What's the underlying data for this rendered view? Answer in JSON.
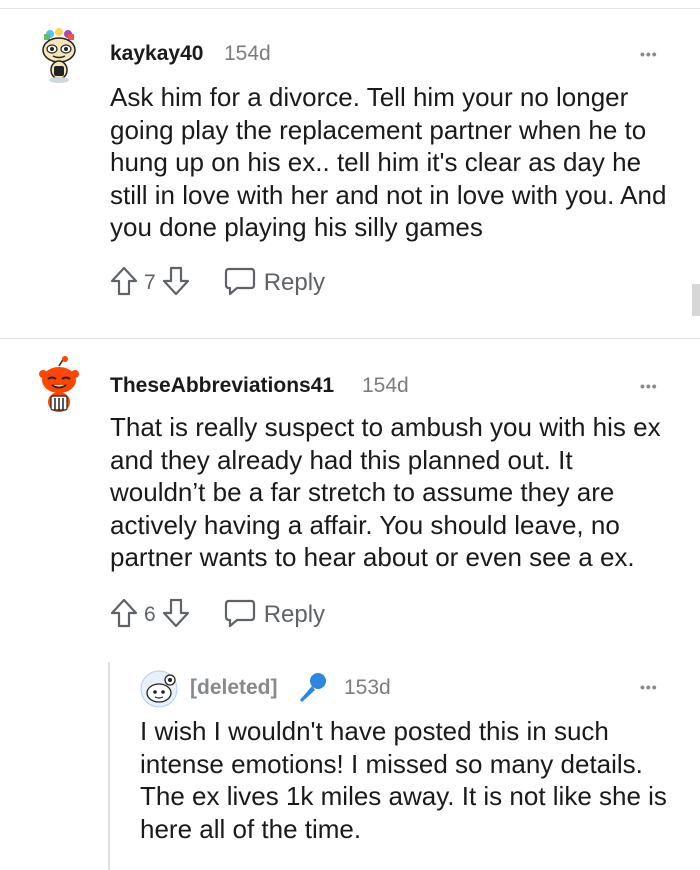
{
  "comments": [
    {
      "username": "kaykay40",
      "age": "154d",
      "body": "Ask him for a divorce. Tell him your no longer going play the replacement partner when he to hung up on his ex.. tell him it's clear as day he still in love with her and not in love with you. And you done playing his silly games",
      "votes": "7",
      "reply_label": "Reply",
      "more": "•••"
    },
    {
      "username": "TheseAbbreviations41",
      "age": "154d",
      "body": "That is really suspect to ambush you with his ex and they already had this planned out. It wouldn’t be a far stretch to assume they are actively having a affair. You should leave, no partner wants to hear about or even see a ex.",
      "votes": "6",
      "reply_label": "Reply",
      "more": "•••"
    },
    {
      "username": "[deleted]",
      "age": "153d",
      "body": "I wish I wouldn't have posted this in such intense emotions! I missed so many details. The ex lives 1k miles away. It is not like she is here all of the time.",
      "more": "•••",
      "flair_icon": "microphone-icon"
    }
  ],
  "colors": {
    "text": "#1a1a1b",
    "muted": "#7c7c7c",
    "icon": "#5f6368",
    "reddit_orange": "#ff4500",
    "flair_blue": "#2b87e0"
  }
}
